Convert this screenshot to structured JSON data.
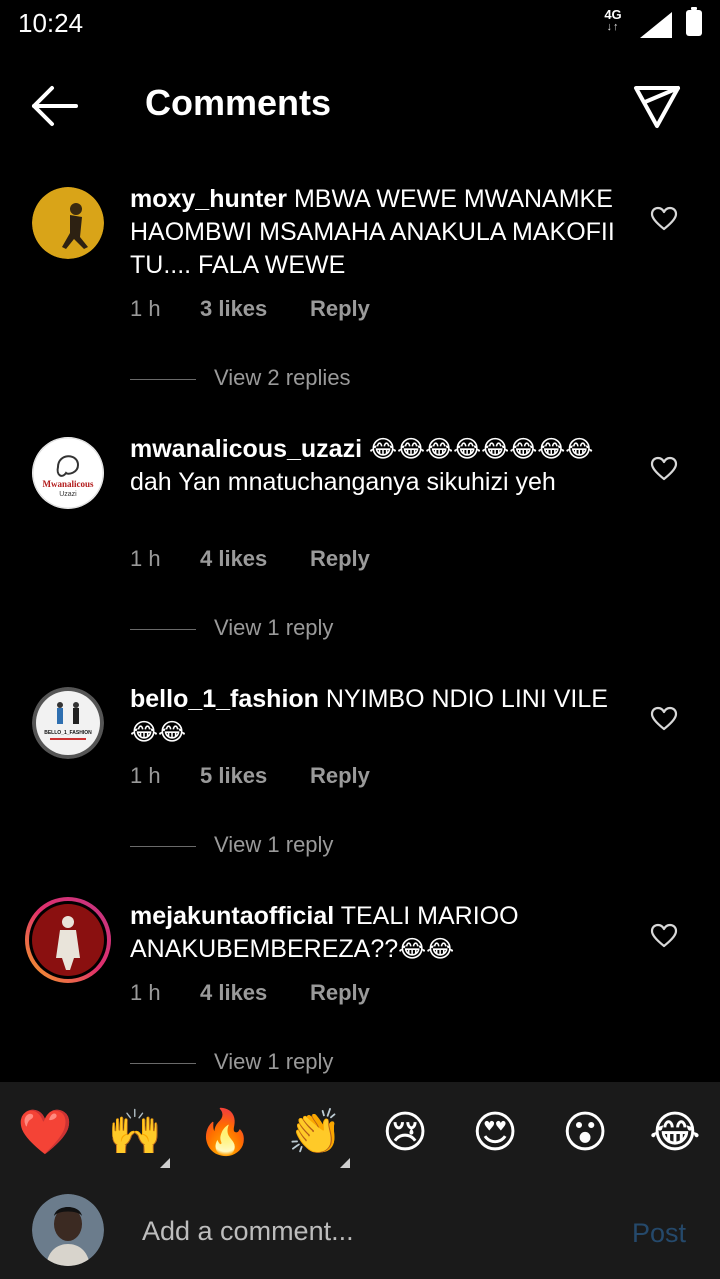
{
  "status_bar": {
    "time": "10:24",
    "network": "4G",
    "network_arrows": "↓↑"
  },
  "header": {
    "title": "Comments"
  },
  "comments": [
    {
      "username": "moxy_hunter",
      "text": "MBWA WEWE MWANAMKE HAOMBWI MSAMAHA ANAKULA MAKOFII TU.... FALA WEWE",
      "time": "1 h",
      "likes": "3 likes",
      "reply_label": "Reply",
      "view_replies": "View 2 replies"
    },
    {
      "username": "mwanalicous_uzazi",
      "emoji_prefix": "😂😂😂😂😂😂😂😂",
      "text": "dah Yan mnatuchanganya sikuhizi yeh",
      "time": "1 h",
      "likes": "4 likes",
      "reply_label": "Reply",
      "view_replies": "View 1 reply",
      "avatar_text": "Mwanalicous",
      "avatar_subtext": "Uzazi"
    },
    {
      "username": "bello_1_fashion",
      "text": "NYIMBO NDIO LINI VILE",
      "emoji_suffix": "😂😂",
      "time": "1 h",
      "likes": "5 likes",
      "reply_label": "Reply",
      "view_replies": "View 1 reply",
      "avatar_text": "BELLO_1_FASHION"
    },
    {
      "username": "mejakuntaofficial",
      "text": "TEALI MARIOO ANAKUBEMBEREZA??",
      "emoji_suffix": "😂😂",
      "time": "1 h",
      "likes": "4 likes",
      "reply_label": "Reply",
      "view_replies": "View 1 reply"
    }
  ],
  "reactions": [
    "❤️",
    "🙌",
    "🔥",
    "👏",
    "😢",
    "😍",
    "😮",
    "😂"
  ],
  "composer": {
    "placeholder": "Add a comment...",
    "post_label": "Post"
  },
  "colors": {
    "background": "#000000",
    "meta_text": "#9a9a9a",
    "bar_background": "#1a1a1a",
    "post_disabled": "#25496b"
  }
}
